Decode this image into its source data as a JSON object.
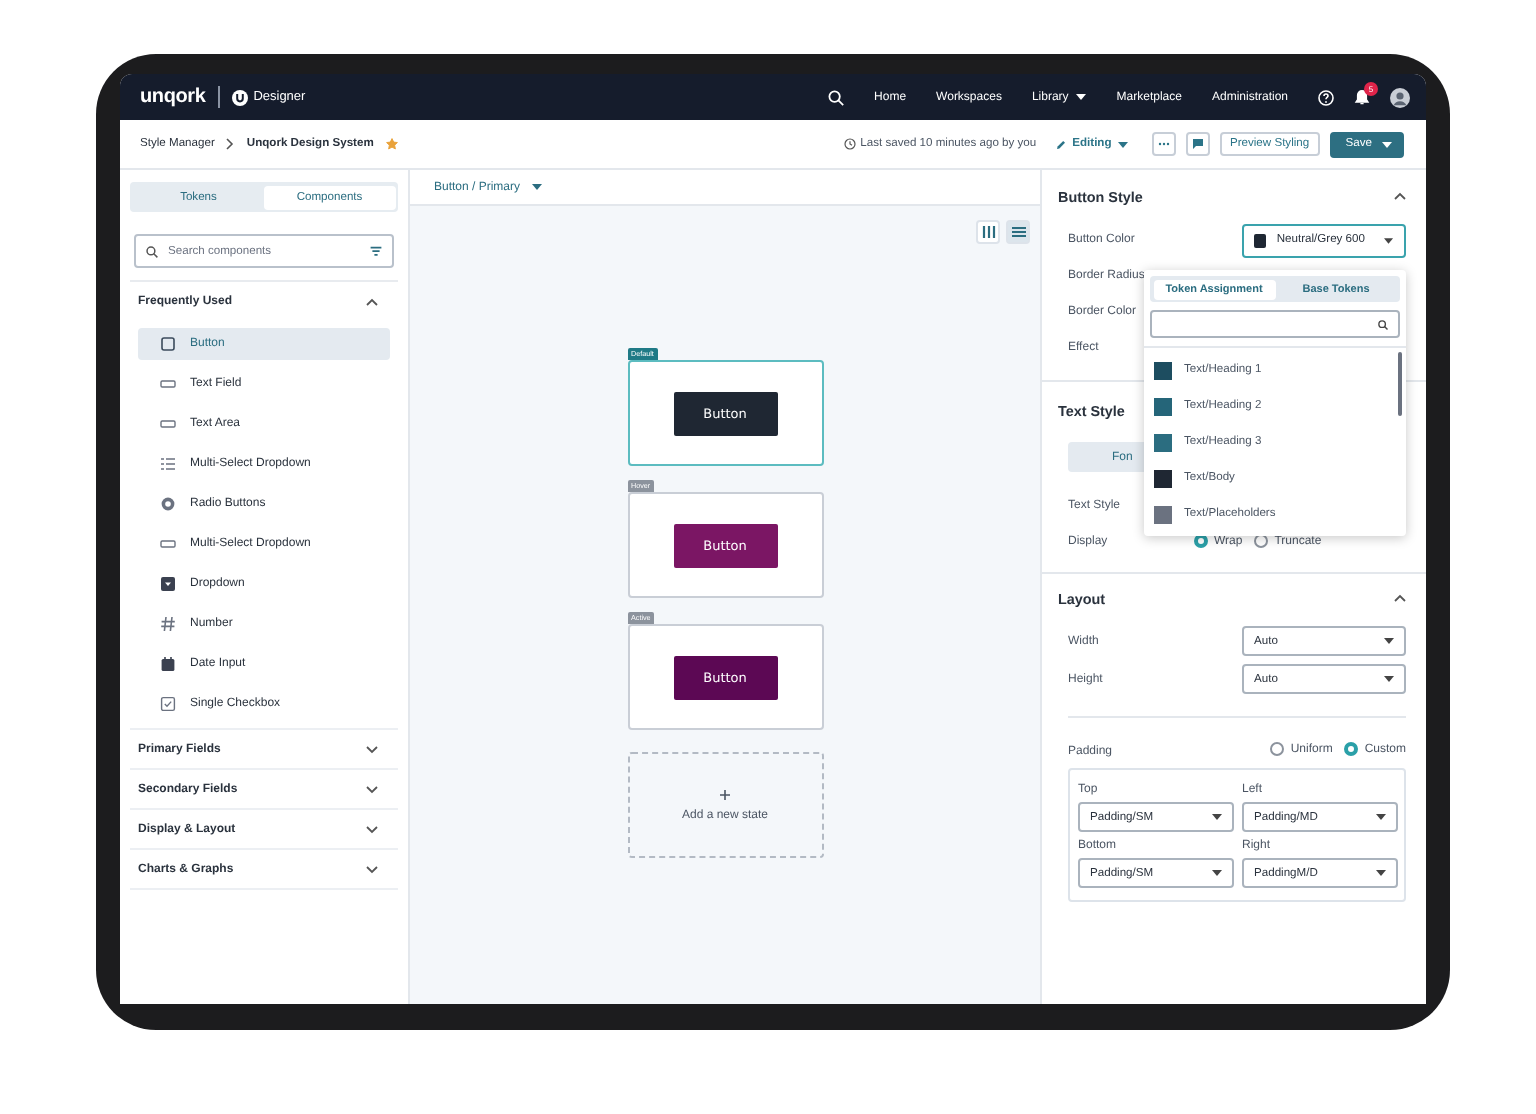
{
  "nav": {
    "brand": "unqork",
    "product": "Designer",
    "links": [
      {
        "label": "Home",
        "dropdown": false
      },
      {
        "label": "Workspaces",
        "dropdown": false
      },
      {
        "label": "Library",
        "dropdown": true
      },
      {
        "label": "Marketplace",
        "dropdown": false
      },
      {
        "label": "Administration",
        "dropdown": false
      }
    ],
    "notification_count": "5"
  },
  "subheader": {
    "breadcrumbs": [
      "Style Manager",
      "Unqork Design System"
    ],
    "favorite": true,
    "last_saved": "Last saved 10 minutes ago by you",
    "mode": "Editing",
    "preview_button": "Preview Styling",
    "save_button": "Save"
  },
  "sidebar": {
    "tabs": [
      {
        "label": "Tokens",
        "selected": false
      },
      {
        "label": "Components",
        "selected": true
      }
    ],
    "search": {
      "placeholder": "Search components"
    },
    "sections": [
      {
        "title": "Frequently Used",
        "expanded": true,
        "items": [
          {
            "label": "Button",
            "kind": "square",
            "selected": true
          },
          {
            "label": "Text Field",
            "kind": "field",
            "selected": false
          },
          {
            "label": "Text Area",
            "kind": "field",
            "selected": false
          },
          {
            "label": "Multi-Select Dropdown",
            "kind": "list",
            "selected": false
          },
          {
            "label": "Radio Buttons",
            "kind": "radio",
            "selected": false
          },
          {
            "label": "Multi-Select Dropdown",
            "kind": "field",
            "selected": false
          },
          {
            "label": "Dropdown",
            "kind": "dropdown",
            "selected": false
          },
          {
            "label": "Number",
            "kind": "hash",
            "selected": false
          },
          {
            "label": "Date Input",
            "kind": "calendar",
            "selected": false
          },
          {
            "label": "Single Checkbox",
            "kind": "checkbox",
            "selected": false
          }
        ]
      },
      {
        "title": "Primary Fields",
        "expanded": false
      },
      {
        "title": "Secondary Fields",
        "expanded": false
      },
      {
        "title": "Display & Layout",
        "expanded": false
      },
      {
        "title": "Charts & Graphs",
        "expanded": false
      }
    ]
  },
  "canvas": {
    "breadcrumb": "Button / Primary",
    "view_modes": [
      {
        "kind": "columns",
        "selected": false
      },
      {
        "kind": "rows",
        "selected": true
      }
    ],
    "states": [
      {
        "label": "Default",
        "button": "Button",
        "color": "#1f2733",
        "selected": true
      },
      {
        "label": "Hover",
        "button": "Button",
        "color": "#7b1664",
        "selected": false
      },
      {
        "label": "Active",
        "button": "Button",
        "color": "#5c0854",
        "selected": false
      }
    ],
    "add_state": "Add a new state"
  },
  "properties": {
    "button_style": {
      "title": "Button Style",
      "expanded": true,
      "fields": [
        {
          "label": "Button Color",
          "value": "Neutral/Grey 600",
          "color": "#1f2733",
          "focused": true
        },
        {
          "label": "Border Radius"
        },
        {
          "label": "Border Color"
        },
        {
          "label": "Effect"
        }
      ]
    },
    "text_style": {
      "title": "Text Style",
      "tab": "Fon",
      "fields": [
        {
          "label": "Text Style"
        }
      ],
      "display": {
        "label": "Display",
        "options": [
          {
            "label": "Wrap",
            "selected": true
          },
          {
            "label": "Truncate",
            "selected": false
          }
        ]
      }
    },
    "layout": {
      "title": "Layout",
      "expanded": true,
      "size_fields": [
        {
          "label": "Width",
          "value": "Auto"
        },
        {
          "label": "Height",
          "value": "Auto"
        }
      ],
      "padding": {
        "label": "Padding",
        "modes": [
          {
            "label": "Uniform",
            "selected": false
          },
          {
            "label": "Custom",
            "selected": true
          }
        ],
        "sides": [
          {
            "label": "Top",
            "value": "Padding/SM"
          },
          {
            "label": "Left",
            "value": "Padding/MD"
          },
          {
            "label": "Bottom",
            "value": "Padding/SM"
          },
          {
            "label": "Right",
            "value": "PaddingM/D"
          }
        ]
      }
    }
  },
  "token_popup": {
    "tabs": [
      {
        "label": "Token Assignment",
        "selected": true
      },
      {
        "label": "Base Tokens",
        "selected": false
      }
    ],
    "tokens": [
      {
        "name": "Text/Heading 1",
        "color": "#1d4d60"
      },
      {
        "name": "Text/Heading 2",
        "color": "#256579"
      },
      {
        "name": "Text/Heading 3",
        "color": "#2b6d80"
      },
      {
        "name": "Text/Body",
        "color": "#1f2733"
      },
      {
        "name": "Text/Placeholders",
        "color": "#6b7280"
      }
    ]
  }
}
